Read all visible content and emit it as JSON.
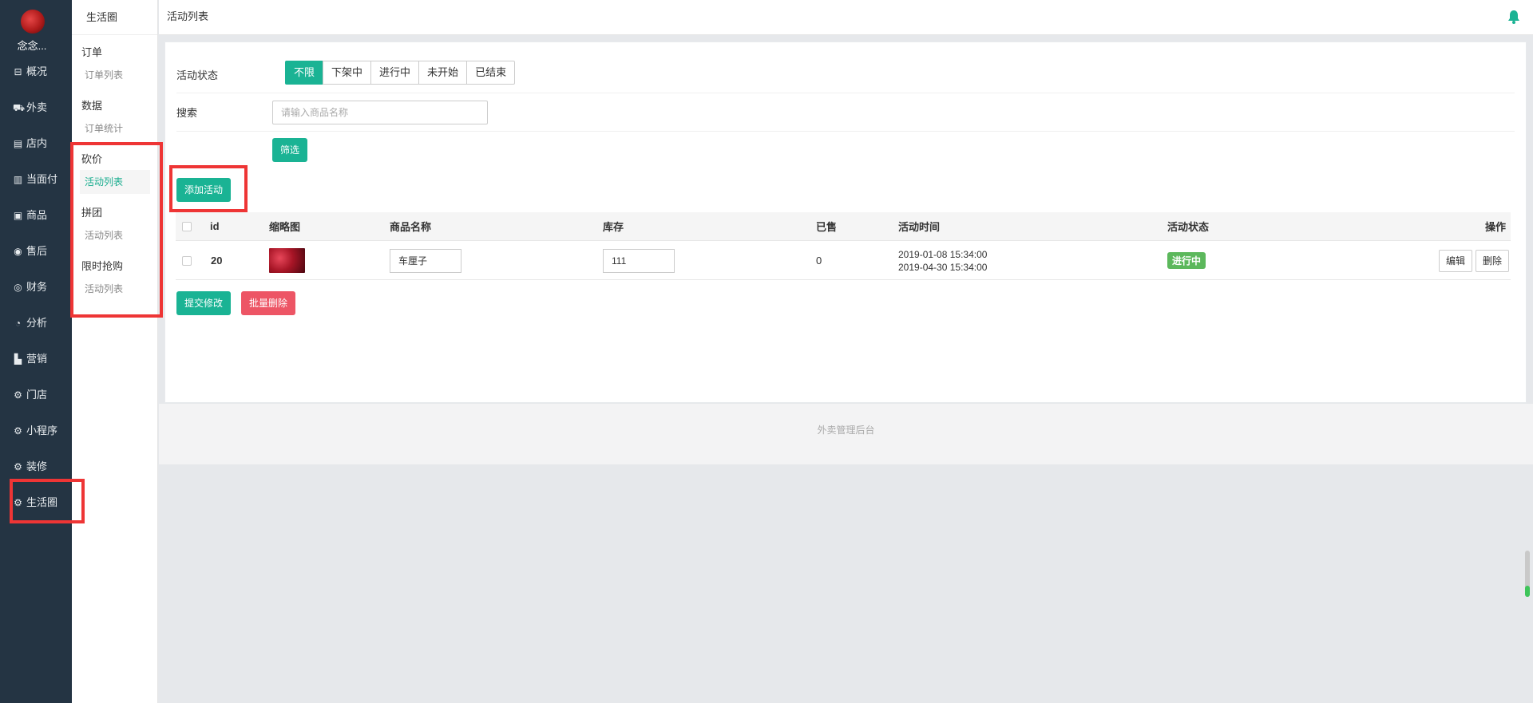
{
  "sidebar": {
    "shop_name": "念念...",
    "items": [
      {
        "icon": "dashboard-icon",
        "glyph": "⊟",
        "label": "概况"
      },
      {
        "icon": "delivery-icon",
        "glyph": "⛟",
        "label": "外卖"
      },
      {
        "icon": "store-icon",
        "glyph": "▤",
        "label": "店内"
      },
      {
        "icon": "receipt-icon",
        "glyph": "▥",
        "label": "当面付"
      },
      {
        "icon": "goods-icon",
        "glyph": "▣",
        "label": "商品"
      },
      {
        "icon": "after-sale-icon",
        "glyph": "◉",
        "label": "售后"
      },
      {
        "icon": "finance-icon",
        "glyph": "◎",
        "label": "财务"
      },
      {
        "icon": "analysis-icon",
        "glyph": "◔",
        "label": "分析"
      },
      {
        "icon": "marketing-icon",
        "glyph": "▙",
        "label": "营销"
      },
      {
        "icon": "gear-icon",
        "glyph": "⚙",
        "label": "门店"
      },
      {
        "icon": "gear-icon",
        "glyph": "⚙",
        "label": "小程序"
      },
      {
        "icon": "gear-icon",
        "glyph": "⚙",
        "label": "装修"
      },
      {
        "icon": "gear-icon",
        "glyph": "⚙",
        "label": "生活圈"
      }
    ]
  },
  "subnav": {
    "title": "生活圈",
    "groups": [
      {
        "label": "订单",
        "items": [
          {
            "label": "订单列表",
            "active": false
          }
        ]
      },
      {
        "label": "数据",
        "items": [
          {
            "label": "订单统计",
            "active": false
          }
        ]
      },
      {
        "label": "砍价",
        "items": [
          {
            "label": "活动列表",
            "active": true
          }
        ]
      },
      {
        "label": "拼团",
        "items": [
          {
            "label": "活动列表",
            "active": false
          }
        ]
      },
      {
        "label": "限时抢购",
        "items": [
          {
            "label": "活动列表",
            "active": false
          }
        ]
      }
    ]
  },
  "header": {
    "title": "活动列表",
    "accent": "#1ab394"
  },
  "filter": {
    "status_label": "活动状态",
    "status_options": [
      "不限",
      "下架中",
      "进行中",
      "未开始",
      "已结束"
    ],
    "status_selected": "不限",
    "search_label": "搜索",
    "search_placeholder": "请输入商品名称",
    "filter_button": "筛选"
  },
  "add_button": "添加活动",
  "table": {
    "columns": [
      "id",
      "缩略图",
      "商品名称",
      "库存",
      "已售",
      "活动时间",
      "活动状态",
      "操作"
    ],
    "rows": [
      {
        "id": "20",
        "name": "车厘子",
        "stock": "111",
        "sold": "0",
        "start": "2019-01-08 15:34:00",
        "end": "2019-04-30 15:34:00",
        "status": "进行中",
        "edit": "编辑",
        "delete": "删除"
      }
    ]
  },
  "actions": {
    "submit": "提交修改",
    "batch_delete": "批量删除"
  },
  "footer": "外卖管理后台"
}
